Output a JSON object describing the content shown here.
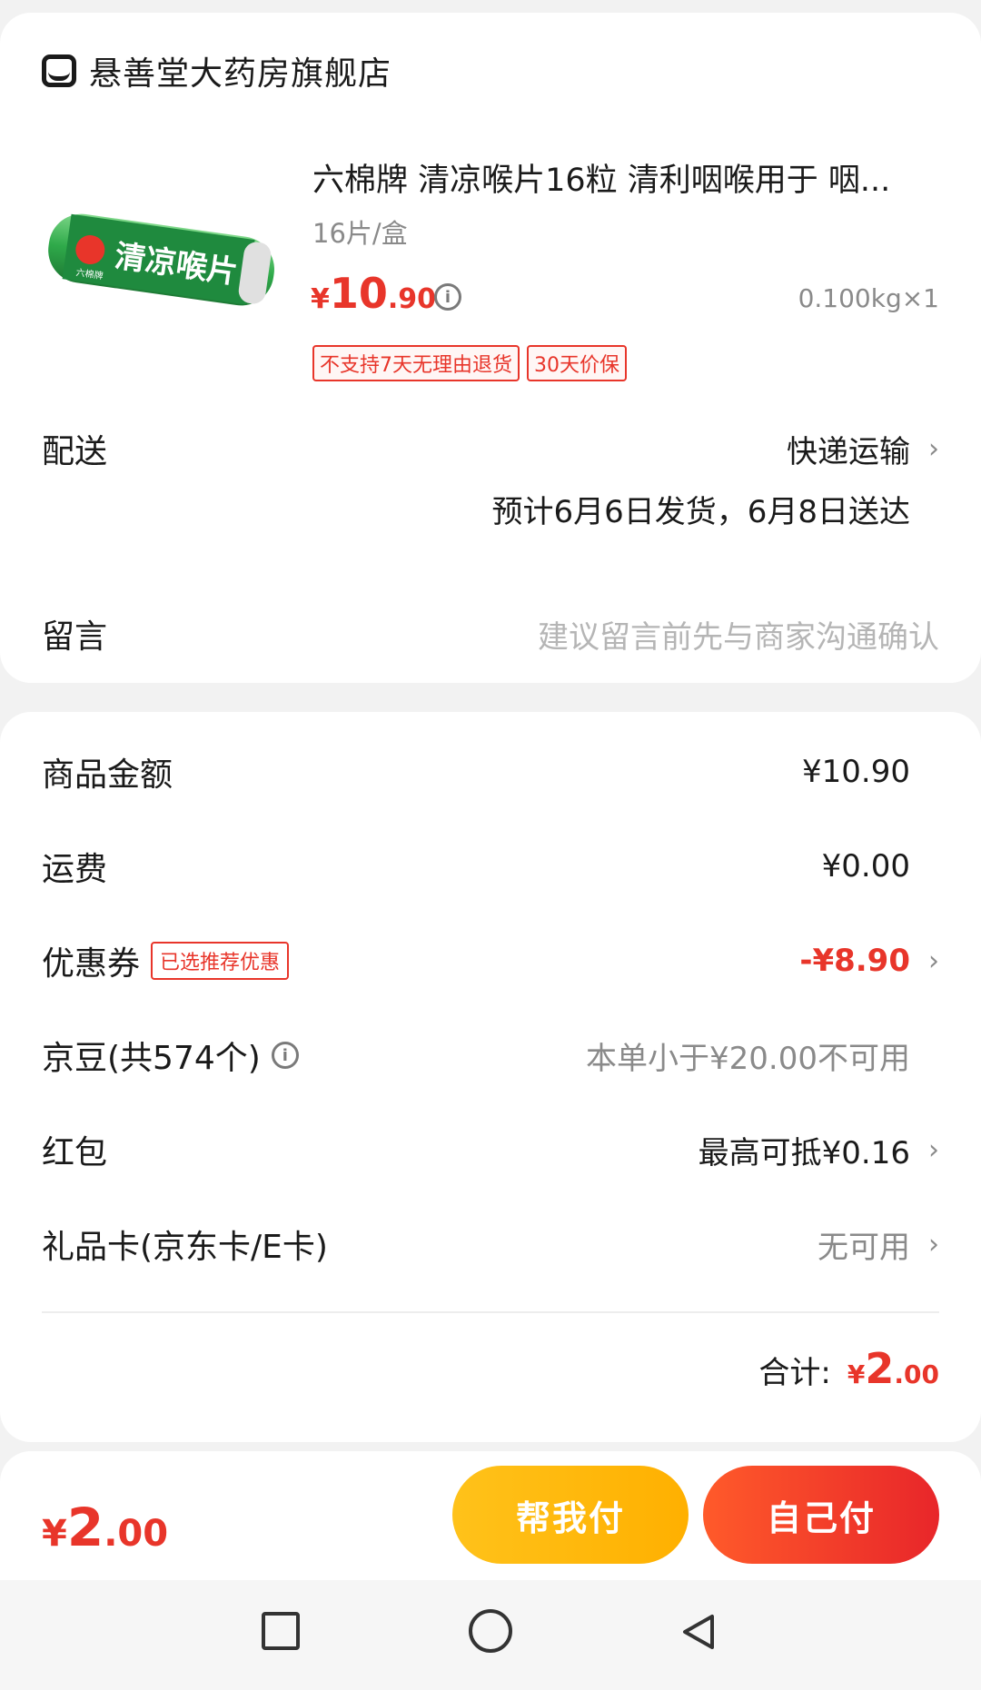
{
  "store": {
    "name": "悬善堂大药房旗舰店",
    "icon": "store-icon"
  },
  "product": {
    "title": "六棉牌 清凉喉片16粒 清利咽喉用于 咽...",
    "spec": "16片/盒",
    "price_currency": "¥",
    "price_int": "10",
    "price_dec": ".90",
    "weight": "0.100kg×1",
    "tags": [
      "不支持7天无理由退货",
      "30天价保"
    ],
    "image_text": "清凉喉片",
    "image_brand": "六棉牌"
  },
  "delivery": {
    "label": "配送",
    "method": "快递运输",
    "estimate": "预计6月6日发货，6月8日送达"
  },
  "remark": {
    "label": "留言",
    "placeholder": "建议留言前先与商家沟通确认"
  },
  "amounts": {
    "goods_label": "商品金额",
    "goods_value": "¥10.90",
    "shipping_label": "运费",
    "shipping_value": "¥0.00",
    "coupon_label": "优惠券",
    "coupon_badge": "已选推荐优惠",
    "coupon_value": "-¥8.90",
    "jd_beans_label": "京豆(共574个)",
    "jd_beans_value": "本单小于¥20.00不可用",
    "red_packet_label": "红包",
    "red_packet_value": "最高可抵¥0.16",
    "gift_card_label": "礼品卡(京东卡/E卡)",
    "gift_card_value": "无可用"
  },
  "total": {
    "label": "合计:",
    "currency": "¥",
    "int": "2",
    "dec": ".00"
  },
  "bottom": {
    "currency": "¥",
    "int": "2",
    "dec": ".00",
    "help_pay_label": "帮我付",
    "self_pay_label": "自己付"
  },
  "colors": {
    "accent_red": "#e8352a",
    "help_yellow": "#ffb000",
    "self_red": "#e8262a"
  }
}
